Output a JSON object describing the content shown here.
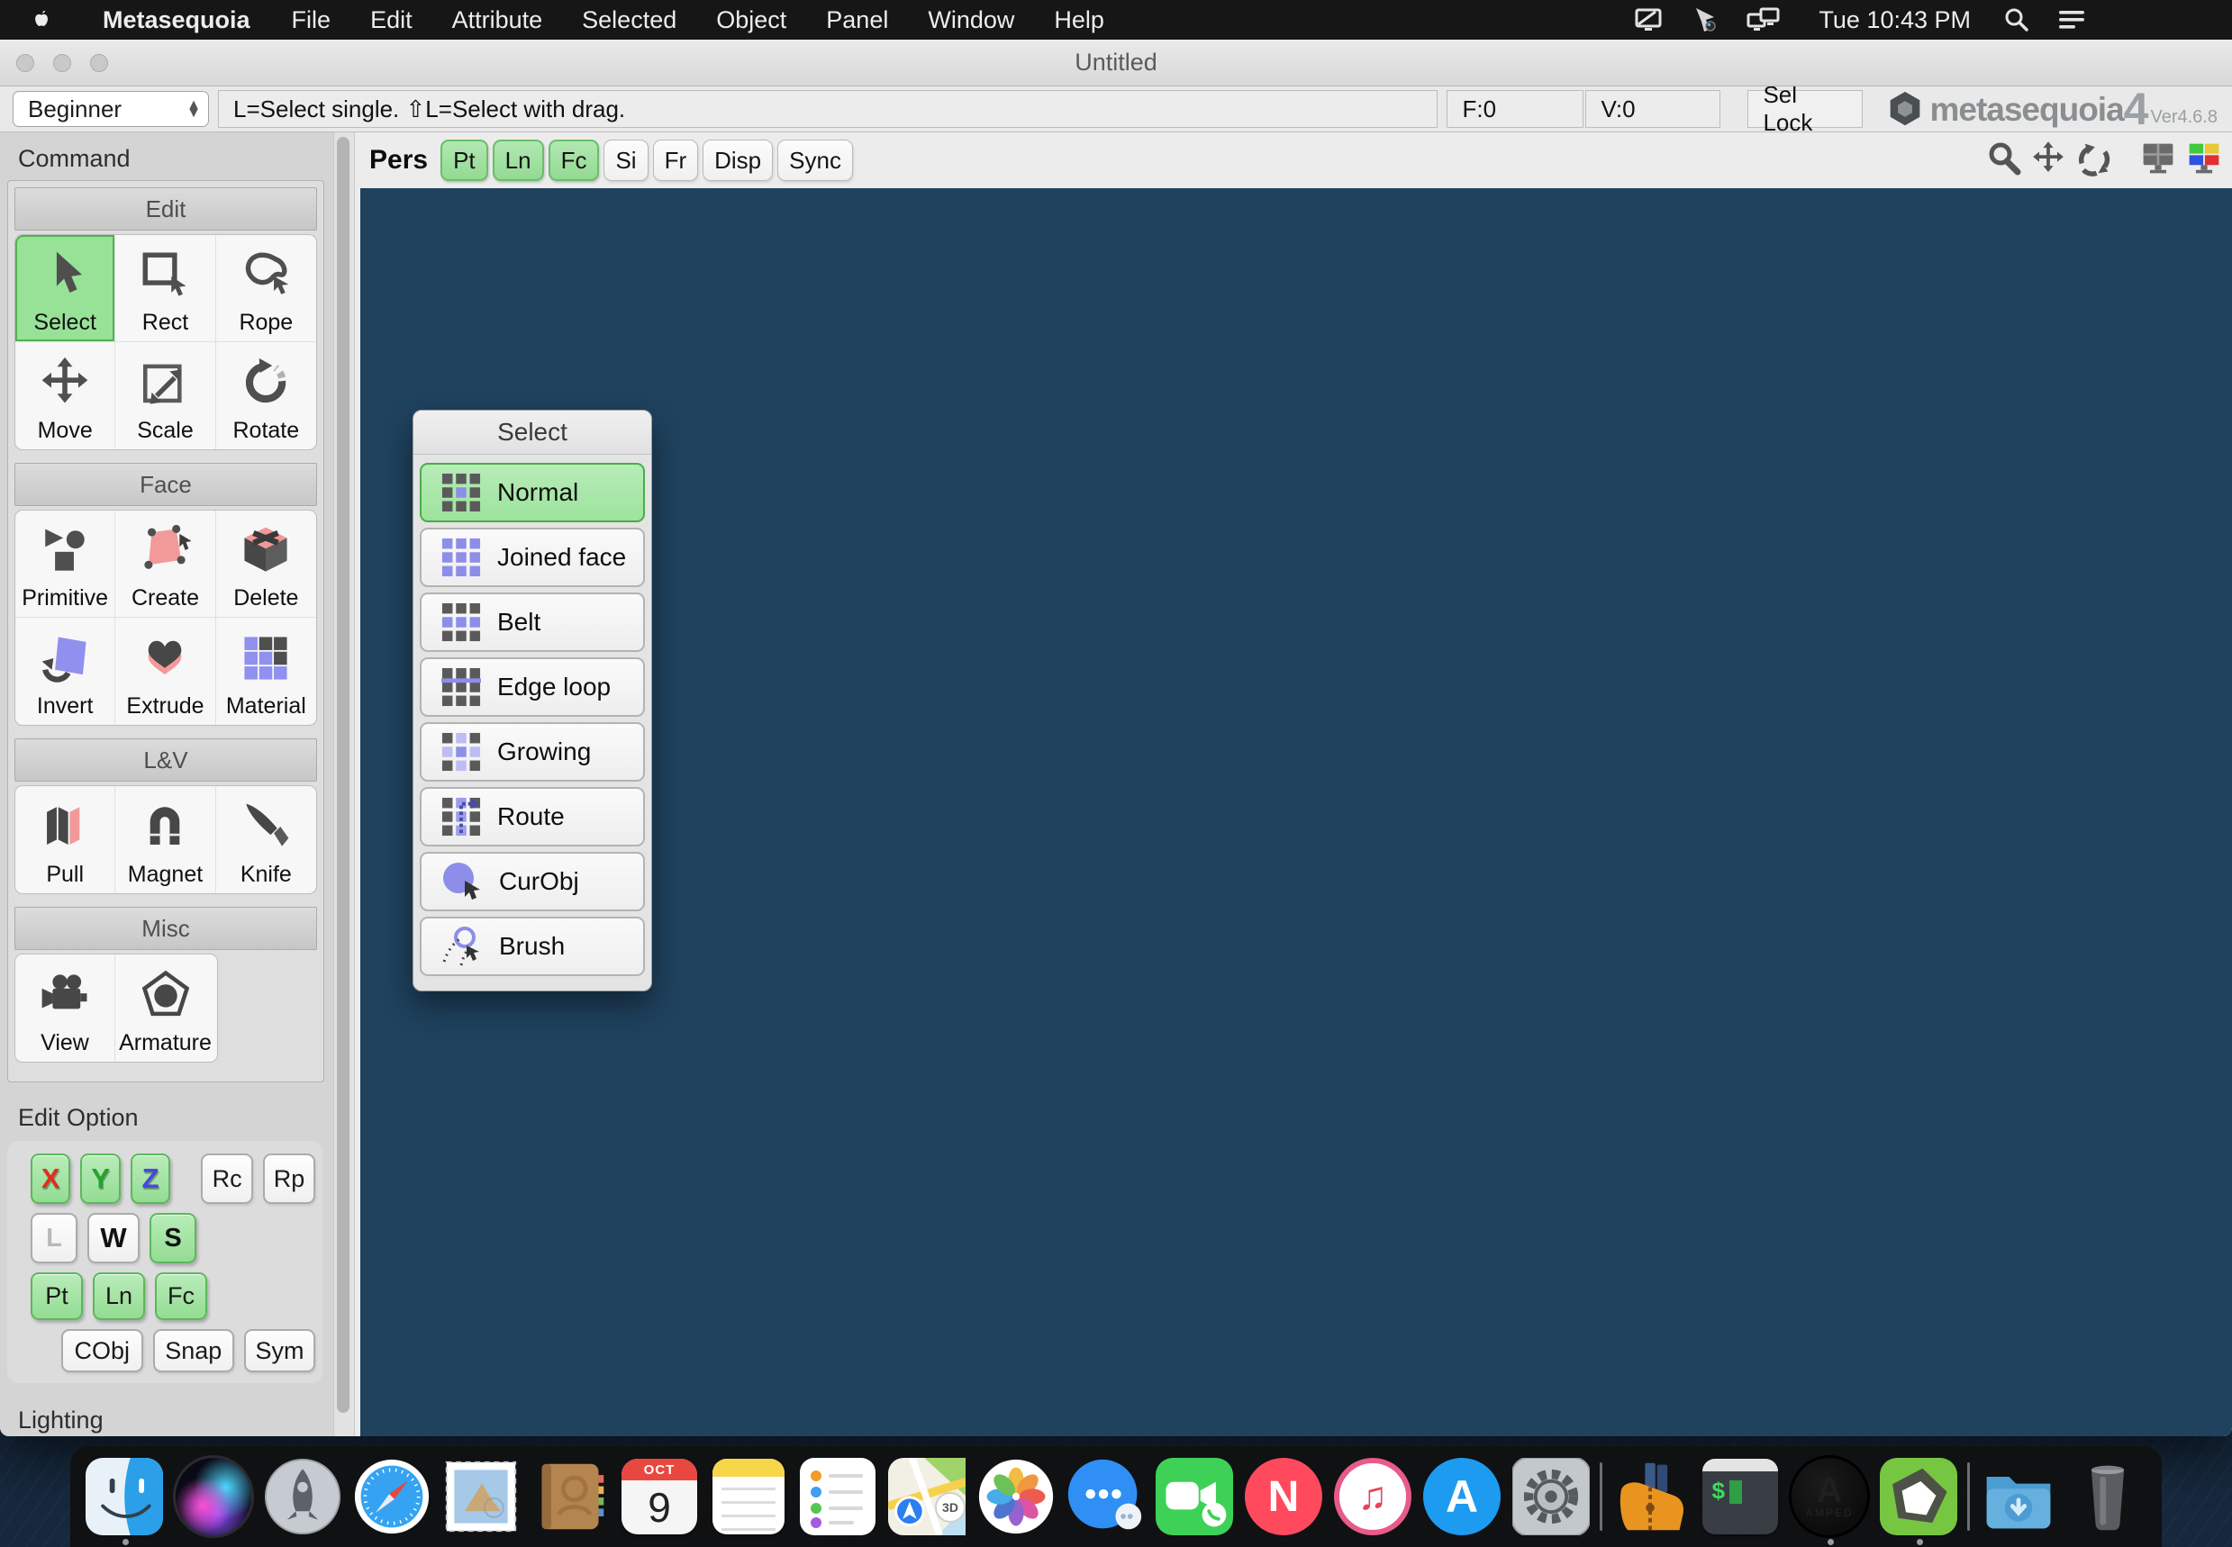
{
  "menu_bar": {
    "app_name": "Metasequoia",
    "menus": [
      "File",
      "Edit",
      "Attribute",
      "Selected",
      "Object",
      "Panel",
      "Window",
      "Help"
    ],
    "clock": "Tue 10:43 PM",
    "status_icons": [
      "display-icon",
      "screen-share-icon",
      "dual-display-icon",
      "spotlight-icon",
      "notification-center-icon"
    ]
  },
  "window": {
    "title": "Untitled",
    "toolbar": {
      "mode": "Beginner",
      "hint": "L=Select single.  ⇧L=Select with drag.",
      "faces": "F:0",
      "vertices": "V:0",
      "sel_lock": "Sel Lock",
      "brand": "metasequoia",
      "brand_number": "4",
      "version": "Ver4.6.8"
    },
    "viewport": {
      "label": "Pers",
      "buttons": [
        {
          "label": "Pt",
          "active": true
        },
        {
          "label": "Ln",
          "active": true
        },
        {
          "label": "Fc",
          "active": true
        },
        {
          "label": "Si",
          "active": false
        },
        {
          "label": "Fr",
          "active": false
        },
        {
          "label": "Disp",
          "active": false
        },
        {
          "label": "Sync",
          "active": false
        }
      ],
      "corner_icons": [
        "zoom-icon",
        "pan-icon",
        "orbit-icon",
        "viewport-layout-icon",
        "viewport-colors-icon"
      ],
      "background_color": "#1f425f"
    },
    "command_panel": {
      "title": "Command",
      "sections": [
        {
          "label": "Edit",
          "tools": [
            {
              "label": "Select",
              "icon": "cursor-icon",
              "active": true
            },
            {
              "label": "Rect",
              "icon": "rect-select-icon",
              "active": false
            },
            {
              "label": "Rope",
              "icon": "lasso-icon",
              "active": false
            },
            {
              "label": "Move",
              "icon": "move-icon",
              "active": false
            },
            {
              "label": "Scale",
              "icon": "scale-icon",
              "active": false
            },
            {
              "label": "Rotate",
              "icon": "rotate-icon",
              "active": false
            }
          ]
        },
        {
          "label": "Face",
          "tools": [
            {
              "label": "Primitive",
              "icon": "primitive-icon",
              "active": false
            },
            {
              "label": "Create",
              "icon": "create-face-icon",
              "active": false
            },
            {
              "label": "Delete",
              "icon": "delete-face-icon",
              "active": false
            },
            {
              "label": "Invert",
              "icon": "invert-icon",
              "active": false
            },
            {
              "label": "Extrude",
              "icon": "extrude-icon",
              "active": false
            },
            {
              "label": "Material",
              "icon": "material-icon",
              "active": false
            }
          ]
        },
        {
          "label": "L&V",
          "tools": [
            {
              "label": "Pull",
              "icon": "pull-icon",
              "active": false
            },
            {
              "label": "Magnet",
              "icon": "magnet-icon",
              "active": false
            },
            {
              "label": "Knife",
              "icon": "knife-icon",
              "active": false
            }
          ]
        },
        {
          "label": "Misc",
          "tools": [
            {
              "label": "View",
              "icon": "camera-icon",
              "active": false
            },
            {
              "label": "Armature",
              "icon": "armature-icon",
              "active": false
            }
          ]
        }
      ],
      "edit_option": {
        "title": "Edit Option",
        "axis_buttons": [
          {
            "label": "X",
            "active": true,
            "letter_color": "#e02f20"
          },
          {
            "label": "Y",
            "active": true,
            "letter_color": "#23a42e"
          },
          {
            "label": "Z",
            "active": true,
            "letter_color": "#4747e2"
          }
        ],
        "rc": "Rc",
        "rp": "Rp",
        "lws": [
          {
            "label": "L",
            "active": false
          },
          {
            "label": "W",
            "active": false
          },
          {
            "label": "S",
            "active": true
          }
        ],
        "plf": [
          {
            "label": "Pt",
            "active": true
          },
          {
            "label": "Ln",
            "active": true
          },
          {
            "label": "Fc",
            "active": true
          }
        ],
        "bottom": [
          "CObj",
          "Snap",
          "Sym"
        ]
      },
      "lighting_label": "Lighting"
    },
    "select_panel": {
      "title": "Select",
      "items": [
        {
          "label": "Normal",
          "icon": "grid-center-icon",
          "active": true
        },
        {
          "label": "Joined face",
          "icon": "grid-all-icon",
          "active": false
        },
        {
          "label": "Belt",
          "icon": "grid-row-icon",
          "active": false
        },
        {
          "label": "Edge loop",
          "icon": "grid-edge-loop-icon",
          "active": false
        },
        {
          "label": "Growing",
          "icon": "grid-cross-icon",
          "active": false
        },
        {
          "label": "Route",
          "icon": "grid-route-icon",
          "active": false
        },
        {
          "label": "CurObj",
          "icon": "current-object-icon",
          "active": false
        },
        {
          "label": "Brush",
          "icon": "brush-icon",
          "active": false
        }
      ]
    }
  },
  "dock": {
    "items": [
      "Finder",
      "Siri",
      "Launchpad",
      "Safari",
      "Mail",
      "Contacts",
      "Calendar",
      "Notes",
      "Reminders",
      "Maps",
      "Photos",
      "Messages",
      "FaceTime",
      "News",
      "iTunes",
      "App Store",
      "System Preferences",
      "Archive Utility",
      "Terminal",
      "Amped",
      "Metasequoia",
      "Downloads",
      "Trash"
    ],
    "running": [
      "Finder",
      "Amped",
      "Metasequoia"
    ],
    "calendar_month": "OCT",
    "calendar_day": "9",
    "maps_badge": "3D",
    "news_initial": "N",
    "itunes_glyph": "♫",
    "appstore_initial": "A",
    "terminal_prompt": "$",
    "amped_initial": "A",
    "amped_label": "AMPED"
  },
  "colors": {
    "viewport_blue": "#1f425f",
    "active_green": "#97e297",
    "active_green_border": "#54b054",
    "panel_gray": "#d4d4d4",
    "icon_purple": "#8d8dea",
    "icon_pink": "#f29a9a",
    "icon_gray": "#4f4f4f",
    "menubar_black": "#161616"
  }
}
